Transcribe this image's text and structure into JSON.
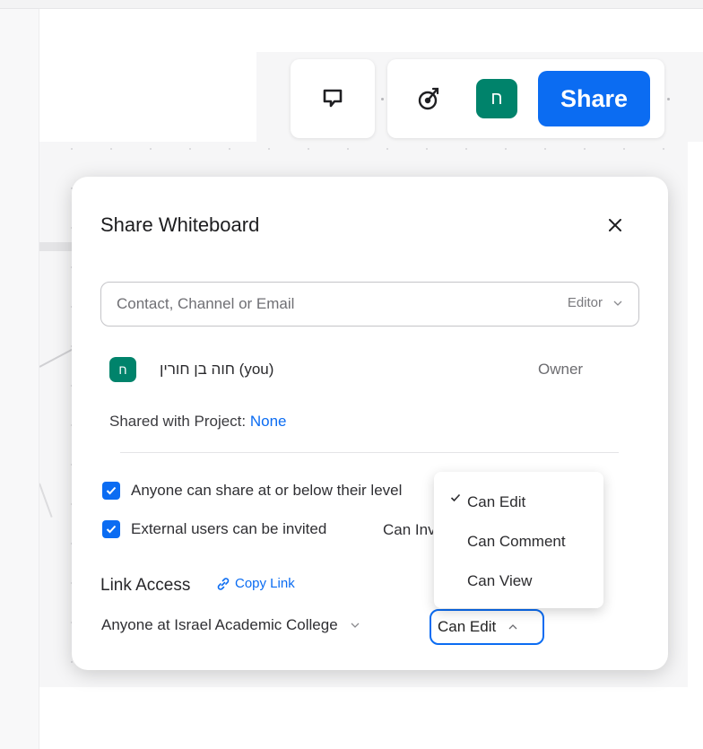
{
  "toolbar": {
    "avatar_initial": "ח",
    "share_label": "Share"
  },
  "dialog": {
    "title": "Share Whiteboard",
    "invite": {
      "placeholder": "Contact, Channel or Email",
      "role": "Editor"
    },
    "member": {
      "avatar_initial": "ח",
      "name": "חוה בן חורין (you)",
      "role": "Owner"
    },
    "shared_with": {
      "label": "Shared with Project:",
      "value": "None"
    },
    "options": [
      {
        "label": "Anyone can share at or below their level",
        "checked": true
      },
      {
        "label": "External users can be invited",
        "checked": true,
        "value": "Can Invite"
      }
    ],
    "link_access": {
      "label": "Link Access",
      "copy_label": "Copy Link",
      "scope": "Anyone at Israel Academic College",
      "permission": "Can Edit"
    },
    "permission_menu": [
      {
        "label": "Can Edit",
        "selected": true
      },
      {
        "label": "Can Comment",
        "selected": false
      },
      {
        "label": "Can View",
        "selected": false
      }
    ]
  },
  "colors": {
    "accent": "#0b6cf2",
    "avatar": "#00836b"
  }
}
